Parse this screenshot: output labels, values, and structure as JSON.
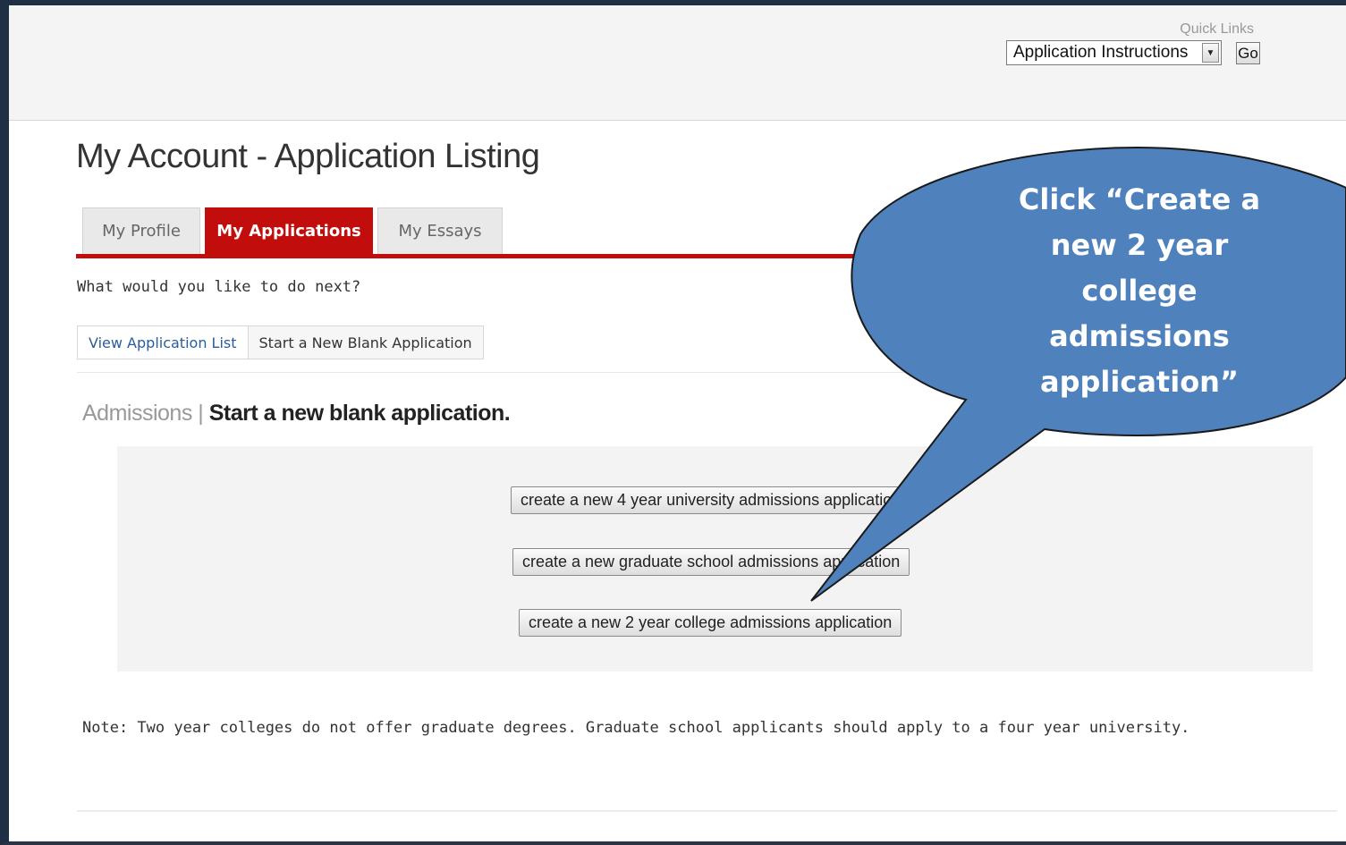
{
  "quick_links": {
    "label": "Quick Links",
    "selected": "Application Instructions",
    "go_label": "Go"
  },
  "page_title": "My Account - Application Listing",
  "tabs": [
    {
      "label": "My Profile",
      "active": false
    },
    {
      "label": "My Applications",
      "active": true
    },
    {
      "label": "My Essays",
      "active": false
    }
  ],
  "prompt": "What would you like to do next?",
  "subtabs": [
    {
      "label": "View Application List"
    },
    {
      "label": "Start a New Blank Application"
    }
  ],
  "section": {
    "prefix": "Admissions",
    "separator": "|",
    "title": "Start a new blank application."
  },
  "buttons": {
    "four_year": "create a new 4 year university admissions application",
    "graduate": "create a new graduate school admissions application",
    "two_year": "create a new 2 year college admissions application"
  },
  "note": "Note: Two year colleges do not offer graduate degrees. Graduate school applicants should apply to a four year university.",
  "callout": {
    "lines": [
      "Click “Create a",
      "new 2 year",
      "college",
      "admissions",
      "application”"
    ],
    "fill_color": "#4f81bd",
    "stroke_color": "#1a1a1a"
  },
  "colors": {
    "accent_red": "#c20d0d",
    "link_blue": "#2a5d9c"
  }
}
